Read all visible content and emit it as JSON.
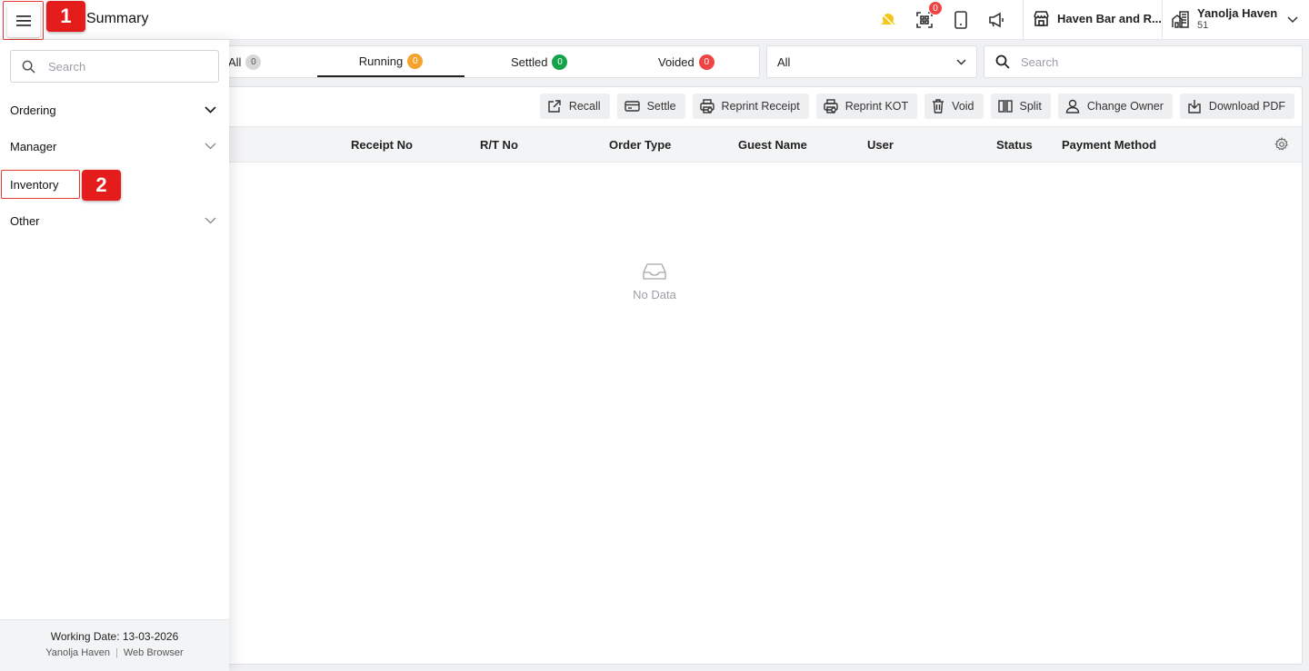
{
  "header": {
    "title": "Summary",
    "notification_count": "0",
    "outlet_name": "Haven Bar and R...",
    "user_name": "Yanolja Haven",
    "user_sub": "51"
  },
  "annotations": {
    "step1": "1",
    "step2": "2"
  },
  "sidebar": {
    "search_placeholder": "Search",
    "items": [
      {
        "label": "Ordering"
      },
      {
        "label": "Manager"
      },
      {
        "label": "Inventory"
      },
      {
        "label": "Other"
      }
    ],
    "footer": {
      "working_date": "Working Date: 13-03-2026",
      "property": "Yanolja Haven",
      "platform": "Web Browser"
    }
  },
  "tabs": [
    {
      "label": "All",
      "count": "0",
      "color": "#d7d7d7"
    },
    {
      "label": "Running",
      "count": "0",
      "color": "#f5a32c"
    },
    {
      "label": "Settled",
      "count": "0",
      "color": "#14a34a"
    },
    {
      "label": "Voided",
      "count": "0",
      "color": "#ef4444"
    }
  ],
  "filter": {
    "selected": "All"
  },
  "search": {
    "placeholder": "Search"
  },
  "actions": [
    {
      "label": "Recall",
      "icon": "external-link-icon"
    },
    {
      "label": "Settle",
      "icon": "card-icon"
    },
    {
      "label": "Reprint Receipt",
      "icon": "printer-icon"
    },
    {
      "label": "Reprint KOT",
      "icon": "printer-icon"
    },
    {
      "label": "Void",
      "icon": "trash-icon"
    },
    {
      "label": "Split",
      "icon": "split-icon"
    },
    {
      "label": "Change Owner",
      "icon": "user-icon"
    },
    {
      "label": "Download PDF",
      "icon": "download-icon"
    }
  ],
  "table": {
    "columns": [
      "Receipt No",
      "R/T No",
      "Order Type",
      "Guest Name",
      "User",
      "Status",
      "Payment Method"
    ],
    "empty_text": "No Data"
  }
}
